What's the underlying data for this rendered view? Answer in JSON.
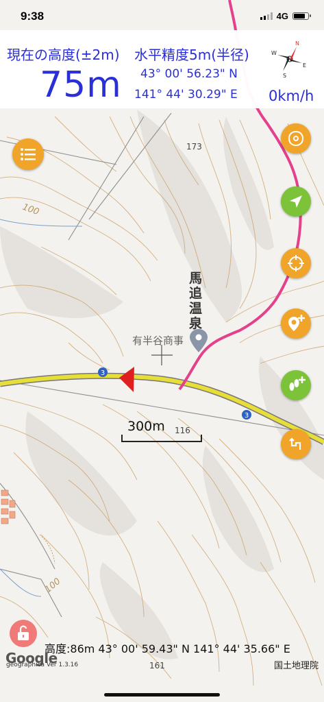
{
  "status_bar": {
    "time": "9:38",
    "network": "4G"
  },
  "header": {
    "altitude_label": "現在の高度(±2m)",
    "altitude_value": "75m",
    "accuracy_label": "水平精度5m(半径)",
    "latitude": "43° 00' 56.23\" N",
    "longitude": "141° 44' 30.29\" E",
    "speed": "0km/h",
    "compass_letters": {
      "n": "N",
      "s": "S",
      "e": "E",
      "w": "W"
    }
  },
  "map": {
    "place_label": "馬追温泉",
    "poi_label": "有半谷商事",
    "route_badges": [
      "3",
      "3"
    ],
    "spot_heights": [
      "173",
      "116",
      "161"
    ],
    "contour_labels": [
      "100",
      "100"
    ],
    "scale_label": "300m"
  },
  "buttons": {
    "menu": "menu-icon",
    "fabs": [
      {
        "name": "layers-button",
        "icon": "swirl-icon",
        "color": "orange"
      },
      {
        "name": "locate-button",
        "icon": "navigation-arrow-icon",
        "color": "green"
      },
      {
        "name": "center-button",
        "icon": "crosshair-icon",
        "color": "orange"
      },
      {
        "name": "add-pin-button",
        "icon": "add-pin-icon",
        "color": "orange"
      },
      {
        "name": "add-track-button",
        "icon": "footprints-add-icon",
        "color": "green"
      },
      {
        "name": "route-button",
        "icon": "route-icon",
        "color": "orange"
      }
    ],
    "lock": "unlock-icon"
  },
  "footer": {
    "info": "高度:86m  43° 00' 59.43\" N 141° 44' 35.66\" E",
    "attribution": "国土地理院",
    "google": "Google",
    "version": "geographica Ver 1.3.16"
  },
  "colors": {
    "accent_blue": "#2a2fd6",
    "orange": "#f0a52a",
    "green": "#7cc33a",
    "track": "#e4418c",
    "road": "#e8de3a"
  }
}
